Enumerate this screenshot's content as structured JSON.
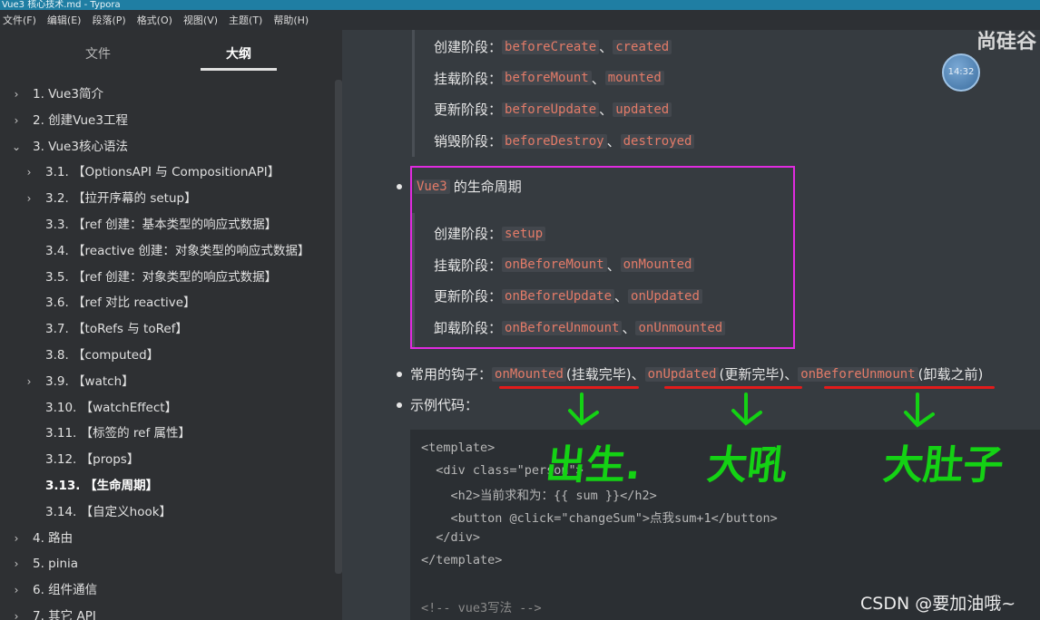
{
  "window": {
    "title": "Vue3 核心技术.md - Typora"
  },
  "menu": [
    "文件(F)",
    "编辑(E)",
    "段落(P)",
    "格式(O)",
    "视图(V)",
    "主题(T)",
    "帮助(H)"
  ],
  "sidebar": {
    "tabs": [
      "文件",
      "大纲"
    ],
    "active_tab": "大纲",
    "items": [
      {
        "label": "1. Vue3简介",
        "level": 1,
        "arrow": "›"
      },
      {
        "label": "2. 创建Vue3工程",
        "level": 1,
        "arrow": "›"
      },
      {
        "label": "3. Vue3核心语法",
        "level": 1,
        "arrow": "⌄"
      },
      {
        "label": "3.1. 【OptionsAPI 与 CompositionAPI】",
        "level": 2,
        "arrow": "›"
      },
      {
        "label": "3.2. 【拉开序幕的 setup】",
        "level": 2,
        "arrow": "›"
      },
      {
        "label": "3.3. 【ref 创建：基本类型的响应式数据】",
        "level": 2,
        "arrow": ""
      },
      {
        "label": "3.4. 【reactive 创建：对象类型的响应式数据】",
        "level": 2,
        "arrow": ""
      },
      {
        "label": "3.5. 【ref 创建：对象类型的响应式数据】",
        "level": 2,
        "arrow": ""
      },
      {
        "label": "3.6. 【ref 对比 reactive】",
        "level": 2,
        "arrow": ""
      },
      {
        "label": "3.7. 【toRefs 与 toRef】",
        "level": 2,
        "arrow": ""
      },
      {
        "label": "3.8. 【computed】",
        "level": 2,
        "arrow": ""
      },
      {
        "label": "3.9. 【watch】",
        "level": 2,
        "arrow": "›"
      },
      {
        "label": "3.10. 【watchEffect】",
        "level": 2,
        "arrow": ""
      },
      {
        "label": "3.11. 【标签的 ref 属性】",
        "level": 2,
        "arrow": ""
      },
      {
        "label": "3.12. 【props】",
        "level": 2,
        "arrow": ""
      },
      {
        "label": "3.13. 【生命周期】",
        "level": 2,
        "arrow": "",
        "active": true
      },
      {
        "label": "3.14. 【自定义hook】",
        "level": 2,
        "arrow": ""
      },
      {
        "label": "4. 路由",
        "level": 1,
        "arrow": "›"
      },
      {
        "label": "5. pinia",
        "level": 1,
        "arrow": "›"
      },
      {
        "label": "6. 组件通信",
        "level": 1,
        "arrow": "›"
      },
      {
        "label": "7. 其它 API",
        "level": 1,
        "arrow": "›"
      }
    ]
  },
  "vue2_lifecycle": [
    {
      "stage": "创建阶段：",
      "hooks": [
        "beforeCreate",
        "created"
      ]
    },
    {
      "stage": "挂载阶段：",
      "hooks": [
        "beforeMount",
        "mounted"
      ]
    },
    {
      "stage": "更新阶段：",
      "hooks": [
        "beforeUpdate",
        "updated"
      ]
    },
    {
      "stage": "销毁阶段：",
      "hooks": [
        "beforeDestroy",
        "destroyed"
      ]
    }
  ],
  "vue3_heading": {
    "code": "Vue3",
    "text": "的生命周期"
  },
  "vue3_lifecycle": [
    {
      "stage": "创建阶段：",
      "hooks": [
        "setup"
      ]
    },
    {
      "stage": "挂载阶段：",
      "hooks": [
        "onBeforeMount",
        "onMounted"
      ]
    },
    {
      "stage": "更新阶段：",
      "hooks": [
        "onBeforeUpdate",
        "onUpdated"
      ]
    },
    {
      "stage": "卸载阶段：",
      "hooks": [
        "onBeforeUnmount",
        "onUnmounted"
      ]
    }
  ],
  "separator": "、",
  "common_hooks": {
    "label": "常用的钩子：",
    "items": [
      {
        "code": "onMounted",
        "note": "(挂载完毕)"
      },
      {
        "code": "onUpdated",
        "note": "(更新完毕)"
      },
      {
        "code": "onBeforeUnmount",
        "note": "(卸载之前)"
      }
    ]
  },
  "example_label": "示例代码：",
  "code_lines": [
    "<template>",
    "  <div class=\"person\">",
    "    <h2>当前求和为：{{ sum }}</h2>",
    "    <button @click=\"changeSum\">点我sum+1</button>",
    "  </div>",
    "</template>",
    "",
    "<!-- vue3写法 -->"
  ],
  "annotations": [
    "出生.",
    "大吼",
    "大肚子"
  ],
  "clock": "14:32",
  "brand": "尚硅谷",
  "watermark": "CSDN @要加油哦~",
  "colors": {
    "accent_box": "#e02be0",
    "code_text": "#e37b68",
    "annotation": "#14d214",
    "underline": "#e21b1b"
  }
}
